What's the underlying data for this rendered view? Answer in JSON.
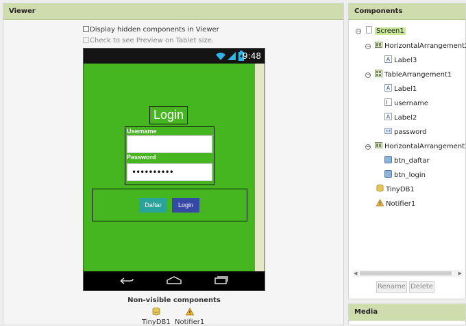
{
  "viewer": {
    "title": "Viewer",
    "show_hidden_label": "Display hidden components in Viewer",
    "tablet_preview_label": "Check to see Preview on Tablet size.",
    "status_time": "9:48",
    "nonvisible_title": "Non-visible components",
    "nonvisible": [
      {
        "label": "TinyDB1",
        "icon": "database-icon"
      },
      {
        "label": "Notifier1",
        "icon": "warning-icon"
      }
    ]
  },
  "app": {
    "title": "Login",
    "username_label": "Username",
    "password_label": "Password",
    "password_value": "••••••••••",
    "daftar_label": "Daftar",
    "login_label": "Login",
    "screen_color": "#45b61f"
  },
  "components": {
    "title": "Components",
    "tree": [
      {
        "label": "Screen1",
        "icon": "screen-icon",
        "selected": true
      },
      {
        "label": "HorizontalArrangement2",
        "icon": "horizontal-arrangement-icon"
      },
      {
        "label": "Label3",
        "icon": "label-icon"
      },
      {
        "label": "TableArrangement1",
        "icon": "table-arrangement-icon"
      },
      {
        "label": "Label1",
        "icon": "label-icon"
      },
      {
        "label": "username",
        "icon": "textbox-icon"
      },
      {
        "label": "Label2",
        "icon": "label-icon"
      },
      {
        "label": "password",
        "icon": "password-textbox-icon"
      },
      {
        "label": "HorizontalArrangement1",
        "icon": "horizontal-arrangement-icon"
      },
      {
        "label": "btn_daftar",
        "icon": "button-icon"
      },
      {
        "label": "btn_login",
        "icon": "button-icon"
      },
      {
        "label": "TinyDB1",
        "icon": "database-icon"
      },
      {
        "label": "Notifier1",
        "icon": "warning-icon"
      }
    ],
    "rename_label": "Rename",
    "delete_label": "Delete"
  },
  "media": {
    "title": "Media"
  }
}
